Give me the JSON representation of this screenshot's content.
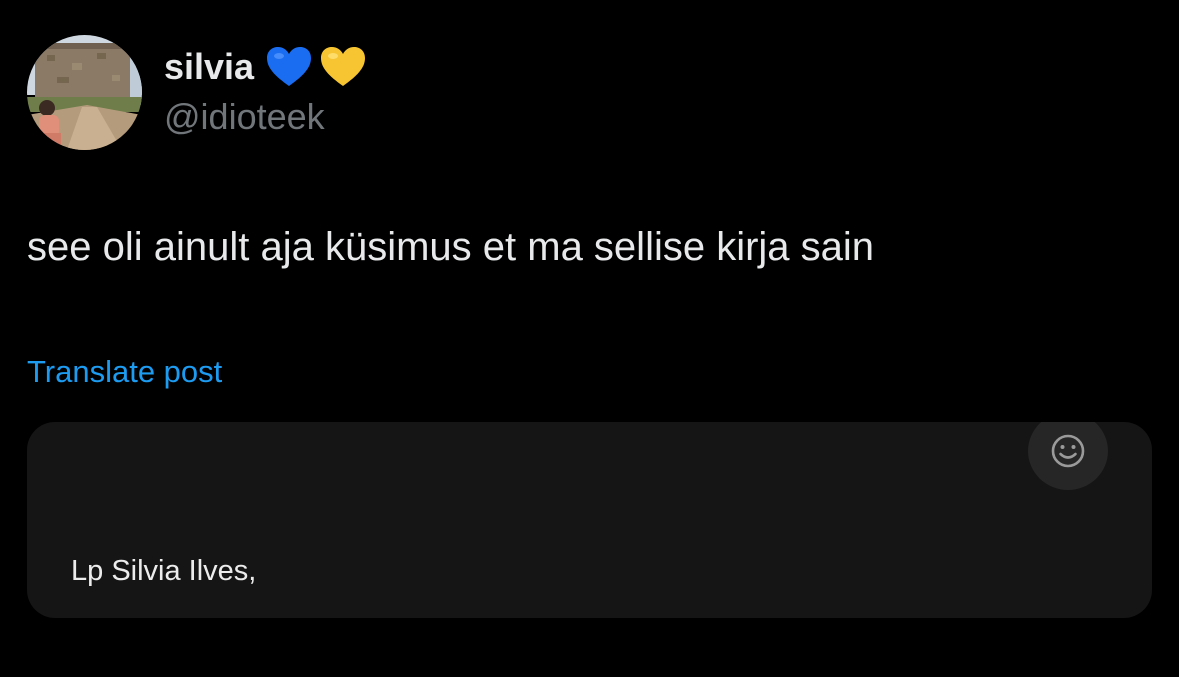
{
  "author": {
    "display_name": "silvia",
    "handle": "@idioteek",
    "badges": [
      "blue-heart-icon",
      "yellow-heart-icon"
    ],
    "avatar_icon": "profile-photo"
  },
  "post": {
    "text": "see oli ainult aja küsimus et ma sellise kirja sain",
    "translate_label": "Translate post"
  },
  "media": {
    "letter_text": "Lp Silvia Ilves,",
    "reaction_icon": "smiley-face-icon"
  },
  "colors": {
    "background": "#000000",
    "primary_text": "#e7e9ea",
    "secondary_text": "#71767b",
    "link": "#1d9bf0",
    "card": "#151515",
    "blue_heart": "#1a6cf0",
    "yellow_heart": "#f7c531"
  }
}
